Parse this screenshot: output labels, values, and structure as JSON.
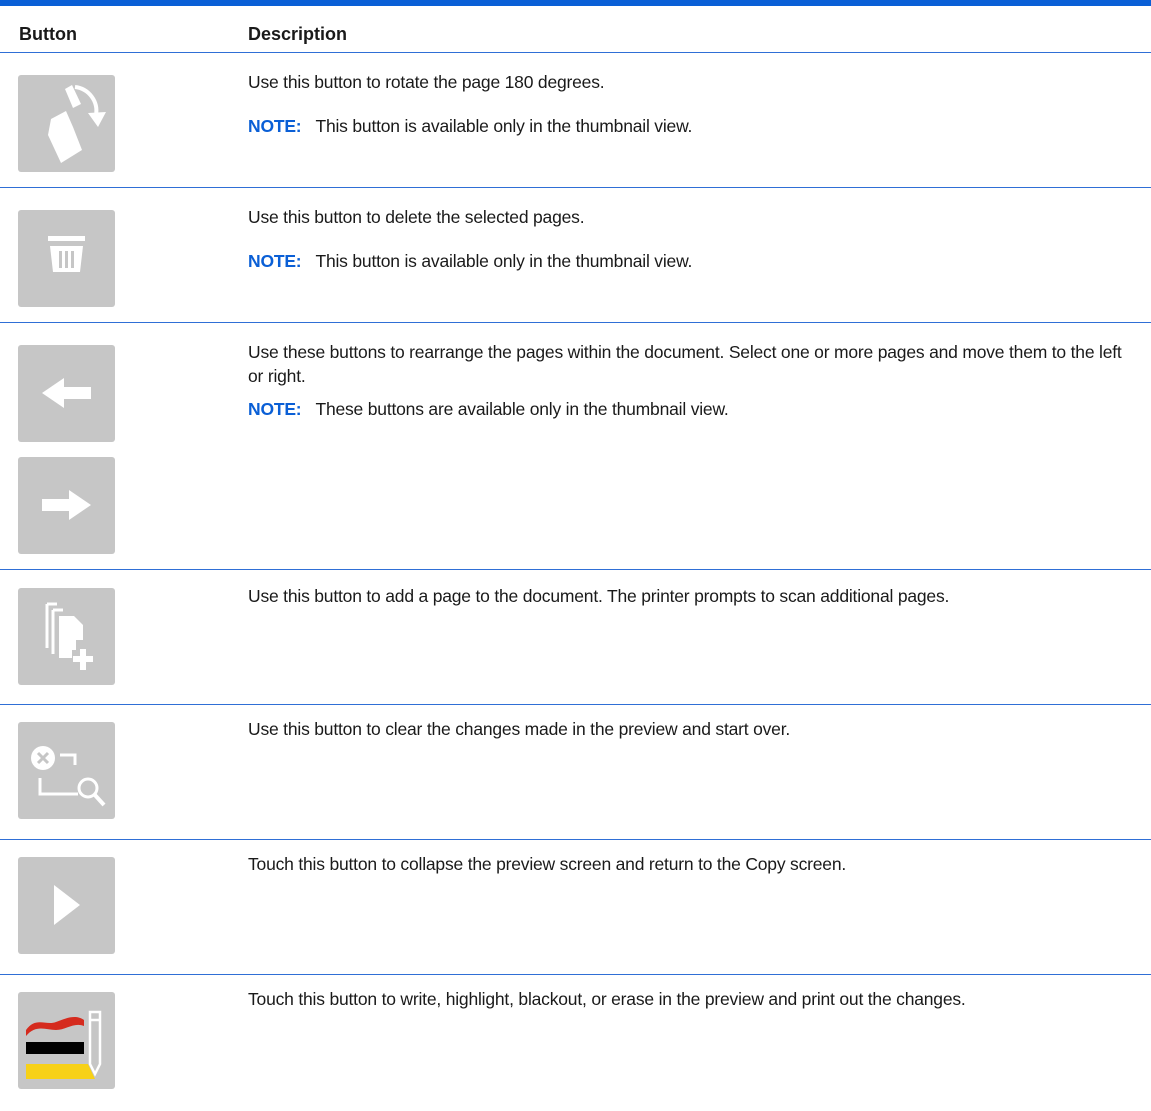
{
  "header": {
    "col_button": "Button",
    "col_description": "Description"
  },
  "rows": [
    {
      "icon": "rotate-page-icon",
      "description": "Use this button to rotate the page 180 degrees.",
      "note_label": "NOTE:",
      "note": "This button is available only in the thumbnail view."
    },
    {
      "icon": "trash-icon",
      "description": "Use this button to delete the selected pages.",
      "note_label": "NOTE:",
      "note": "This button is available only in the thumbnail view."
    },
    {
      "icon": "arrow-left-icon",
      "icon2": "arrow-right-icon",
      "description": "Use these buttons to rearrange the pages within the document. Select one or more pages and move them to the left or right.",
      "note_label": "NOTE:",
      "note": "These buttons are available only in the thumbnail view."
    },
    {
      "icon": "add-page-icon",
      "description": "Use this button to add a page to the document. The printer prompts to scan additional pages."
    },
    {
      "icon": "clear-preview-icon",
      "description": "Use this button to clear the changes made in the preview and start over."
    },
    {
      "icon": "collapse-arrow-icon",
      "description": "Touch this button to collapse the preview screen and return to the Copy screen."
    },
    {
      "icon": "annotate-pencil-icon",
      "description": "Touch this button to write, highlight, blackout, or erase in the preview and print out the changes."
    }
  ],
  "colors": {
    "accent": "#0a5fd6",
    "button_bg": "#c6c6c6",
    "icon_fg": "#ffffff",
    "highlight_red": "#d52b1e",
    "highlight_black": "#000000",
    "highlight_yellow": "#f7d117"
  }
}
